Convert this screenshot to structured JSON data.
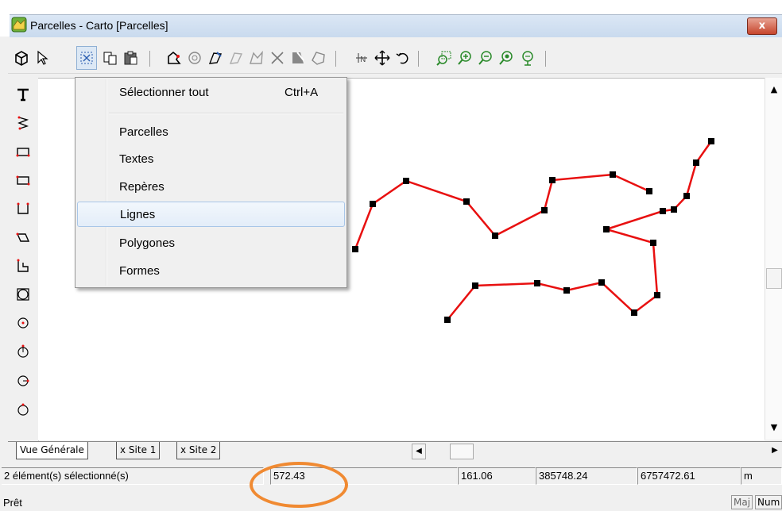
{
  "window": {
    "title": "Parcelles - Carto [Parcelles]",
    "close_label": "x"
  },
  "toolbar": {
    "icons": [
      "3d-cube-icon",
      "pointer-icon",
      "select-icon",
      "copy-icon",
      "paste-icon",
      "parcel-icon",
      "circle-icon",
      "draw-icon",
      "edit-icon",
      "polygon-icon",
      "scissors-icon",
      "cut-icon",
      "shape-icon",
      "north-icon",
      "move-icon",
      "rotate-icon",
      "zoom-window-icon",
      "zoom-in-icon",
      "zoom-out-icon",
      "zoom-fit-icon",
      "zoom-prev-icon"
    ]
  },
  "menu": {
    "items": [
      {
        "label": "Sélectionner tout",
        "shortcut": "Ctrl+A"
      },
      {
        "label": "Parcelles"
      },
      {
        "label": "Textes"
      },
      {
        "label": "Repères"
      },
      {
        "label": "Lignes",
        "highlighted": true
      },
      {
        "label": "Polygones"
      },
      {
        "label": "Formes"
      }
    ]
  },
  "tabs": [
    "Vue Générale",
    "x Site 1",
    "x Site 2"
  ],
  "status": {
    "selection": "2 élément(s) sélectionné(s)",
    "length": "572.43",
    "value2": "161.06",
    "x": "385748.24",
    "y": "6757472.61",
    "unit": "m"
  },
  "bottom": {
    "ready": "Prêt",
    "caps": "Maj",
    "num": "Num"
  },
  "colors": {
    "line": "#e81010",
    "annotation": "#f08a32",
    "menu_highlight": "#a8c6e8"
  },
  "lines": [
    [
      [
        447,
        313
      ],
      [
        469,
        256
      ],
      [
        511,
        227
      ],
      [
        587,
        253
      ],
      [
        623,
        296
      ],
      [
        685,
        264
      ],
      [
        695,
        226
      ],
      [
        771,
        219
      ],
      [
        817,
        240
      ]
    ],
    [
      [
        895,
        177
      ],
      [
        876,
        204
      ],
      [
        864,
        246
      ],
      [
        848,
        263
      ],
      [
        834,
        265
      ],
      [
        763,
        288
      ],
      [
        822,
        305
      ],
      [
        827,
        371
      ],
      [
        798,
        393
      ],
      [
        757,
        355
      ],
      [
        713,
        365
      ],
      [
        676,
        356
      ],
      [
        598,
        359
      ],
      [
        563,
        402
      ]
    ]
  ]
}
